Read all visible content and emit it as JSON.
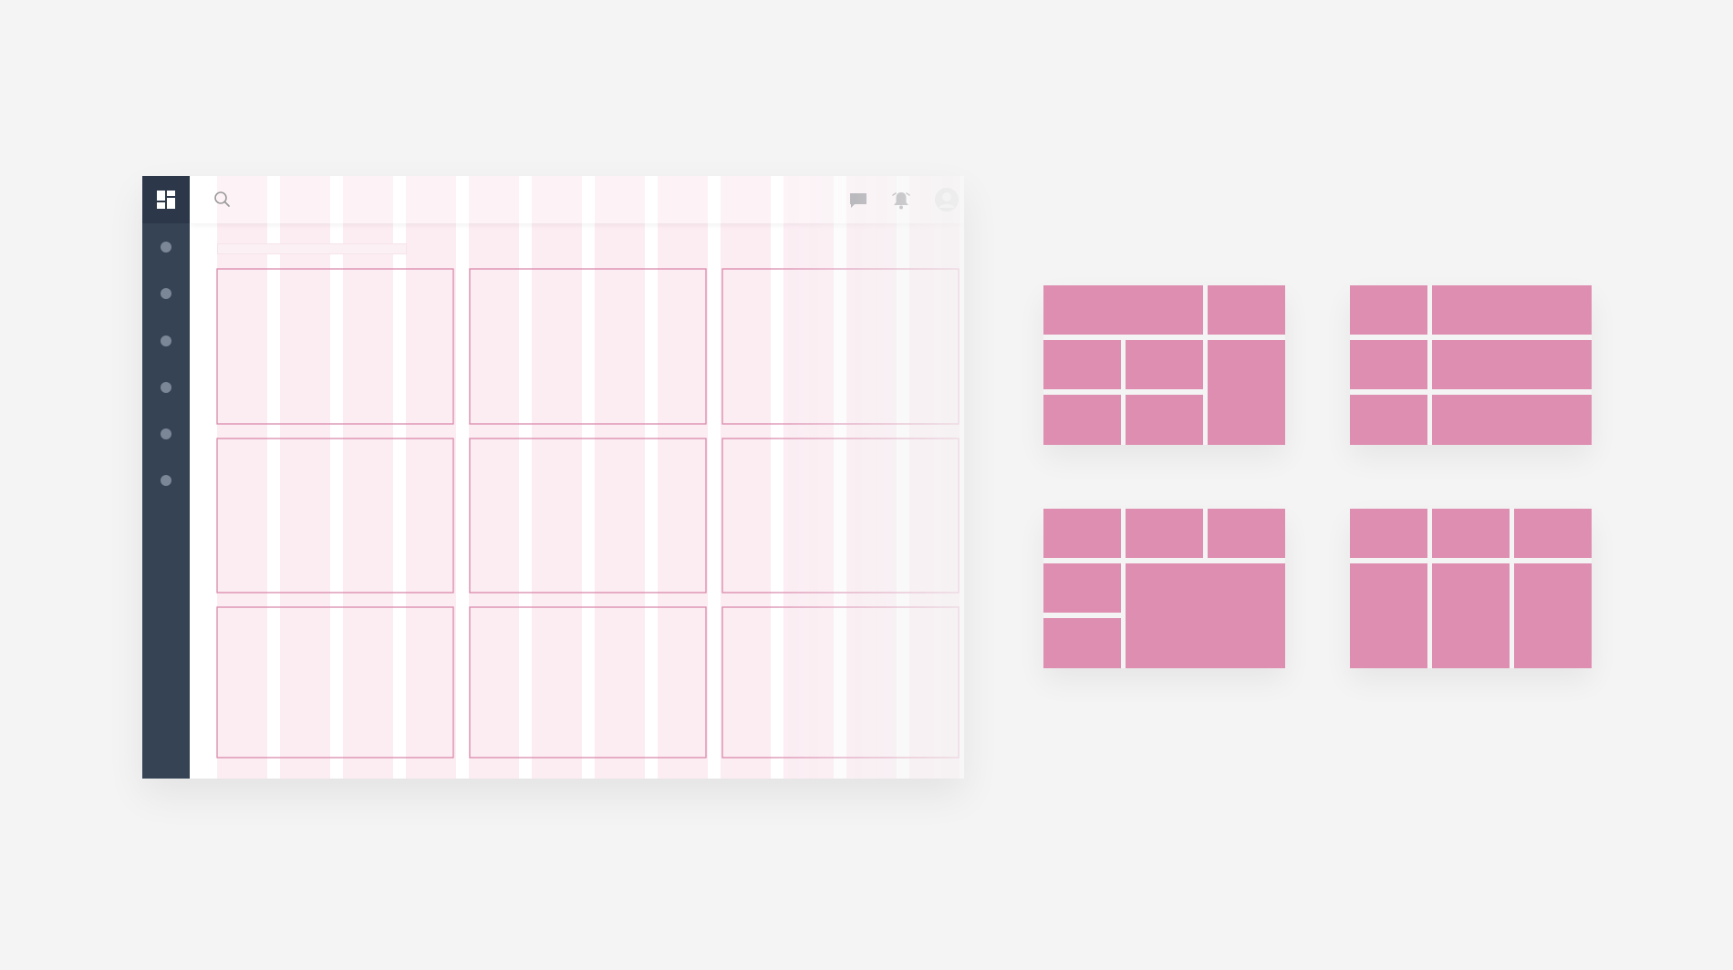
{
  "colors": {
    "background": "#f4f4f4",
    "sidebar": "#354355",
    "sidebar_logo": "#2c3849",
    "column_tint": "#fcedf3",
    "grid_line": "#d98aac",
    "tile": "#de8eb0"
  },
  "header": {
    "logo_icon": "dashboard-icon",
    "search_icon": "search-icon",
    "chat_icon": "chat-icon",
    "bell_icon": "bell-icon",
    "avatar_icon": "user-avatar-icon"
  },
  "sidebar": {
    "items": [
      {
        "icon": "nav-dot-icon"
      },
      {
        "icon": "nav-dot-icon"
      },
      {
        "icon": "nav-dot-icon"
      },
      {
        "icon": "nav-dot-icon"
      },
      {
        "icon": "nav-dot-icon"
      },
      {
        "icon": "nav-dot-icon"
      }
    ]
  },
  "grid": {
    "columns": 12,
    "module_columns": 3,
    "module_rows": 3
  },
  "layouts": [
    {
      "name": "layout-option-1",
      "tiles": 7
    },
    {
      "name": "layout-option-2",
      "tiles": 6
    },
    {
      "name": "layout-option-3",
      "tiles": 6
    },
    {
      "name": "layout-option-4",
      "tiles": 6
    }
  ]
}
